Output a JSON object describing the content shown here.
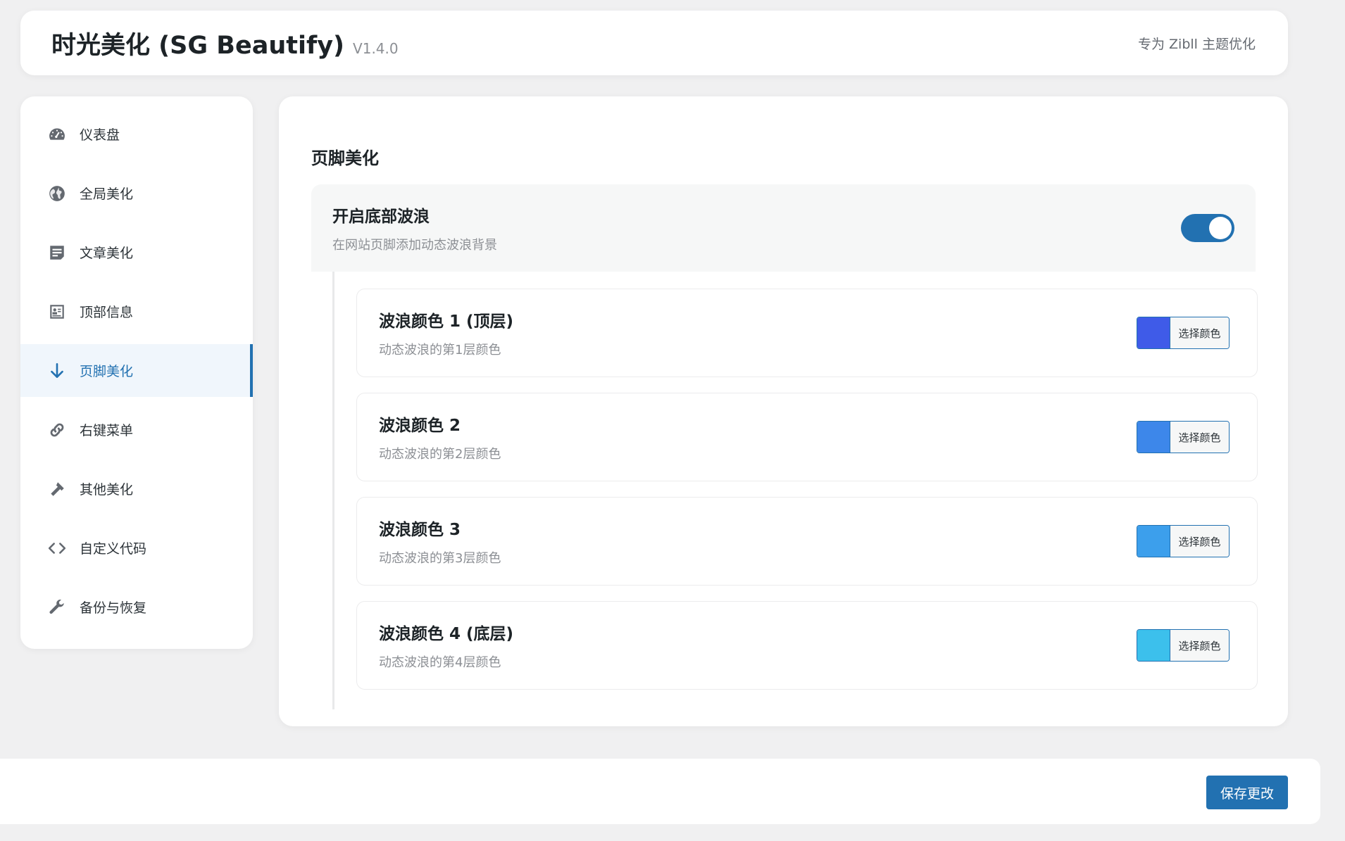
{
  "header": {
    "title": "时光美化 (SG Beautify)",
    "version": "V1.4.0",
    "subtitle": "专为 Zibll 主题优化"
  },
  "sidebar": {
    "items": [
      {
        "label": "仪表盘",
        "icon": "dashboard-icon"
      },
      {
        "label": "全局美化",
        "icon": "globe-icon"
      },
      {
        "label": "文章美化",
        "icon": "document-icon"
      },
      {
        "label": "顶部信息",
        "icon": "id-card-icon"
      },
      {
        "label": "页脚美化",
        "icon": "arrow-down-icon",
        "active": true
      },
      {
        "label": "右键菜单",
        "icon": "link-icon"
      },
      {
        "label": "其他美化",
        "icon": "hammer-icon"
      },
      {
        "label": "自定义代码",
        "icon": "code-icon"
      },
      {
        "label": "备份与恢复",
        "icon": "wrench-icon"
      }
    ]
  },
  "main": {
    "section_title": "页脚美化",
    "master": {
      "label": "开启底部波浪",
      "desc": "在网站页脚添加动态波浪背景",
      "enabled": true
    },
    "colors": [
      {
        "label": "波浪颜色 1 (顶层)",
        "desc": "动态波浪的第1层颜色",
        "value": "#3f5be8",
        "button": "选择颜色"
      },
      {
        "label": "波浪颜色 2",
        "desc": "动态波浪的第2层颜色",
        "value": "#3d87ea",
        "button": "选择颜色"
      },
      {
        "label": "波浪颜色 3",
        "desc": "动态波浪的第3层颜色",
        "value": "#3c9fec",
        "button": "选择颜色"
      },
      {
        "label": "波浪颜色 4 (底层)",
        "desc": "动态波浪的第4层颜色",
        "value": "#3cc0ec",
        "button": "选择颜色"
      }
    ]
  },
  "footer": {
    "save_label": "保存更改"
  },
  "theme": {
    "accent": "#2271b1",
    "background": "#f0f0f1"
  }
}
